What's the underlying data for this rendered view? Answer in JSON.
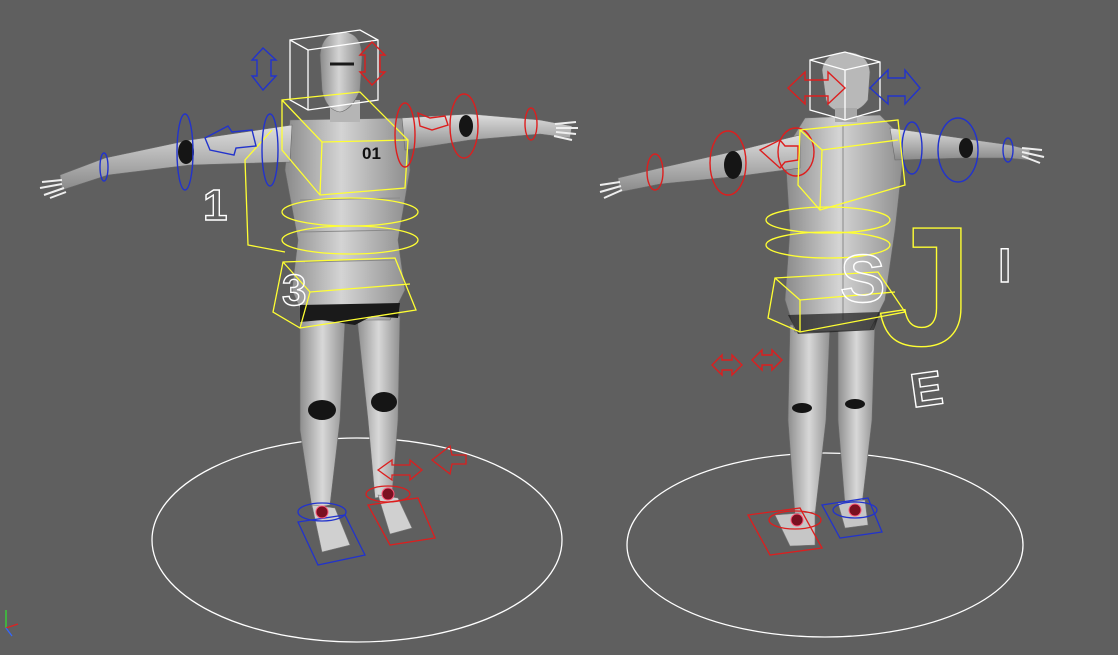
{
  "viewport": {
    "background": "#5f5f5f",
    "labels": {
      "front_chest": "01",
      "front_side_digit": "1",
      "front_spine_digit": "3",
      "back_spine_letter": "S",
      "back_big_letter": "J",
      "back_right_marker": "I",
      "back_lower_letter": "E"
    }
  },
  "colors": {
    "control_yellow": "#ffff33",
    "control_red": "#dd1e1e",
    "control_blue": "#2233cc",
    "ground_circle": "#ffffff",
    "mesh_light": "#c9c9c9",
    "mesh_dark": "#7a7a7a",
    "joint_dark": "#111111"
  },
  "characters": [
    {
      "name": "front-view",
      "icons": [
        "head-box-icon",
        "shoulder-arrow-icon",
        "spine-ring-icon",
        "foot-ik-icon"
      ]
    },
    {
      "name": "back-view",
      "icons": [
        "head-box-icon",
        "shoulder-arrow-icon",
        "spine-ring-icon",
        "foot-ik-icon"
      ]
    }
  ],
  "axis_gizmo": {
    "icon": "axis-gizmo-icon"
  }
}
